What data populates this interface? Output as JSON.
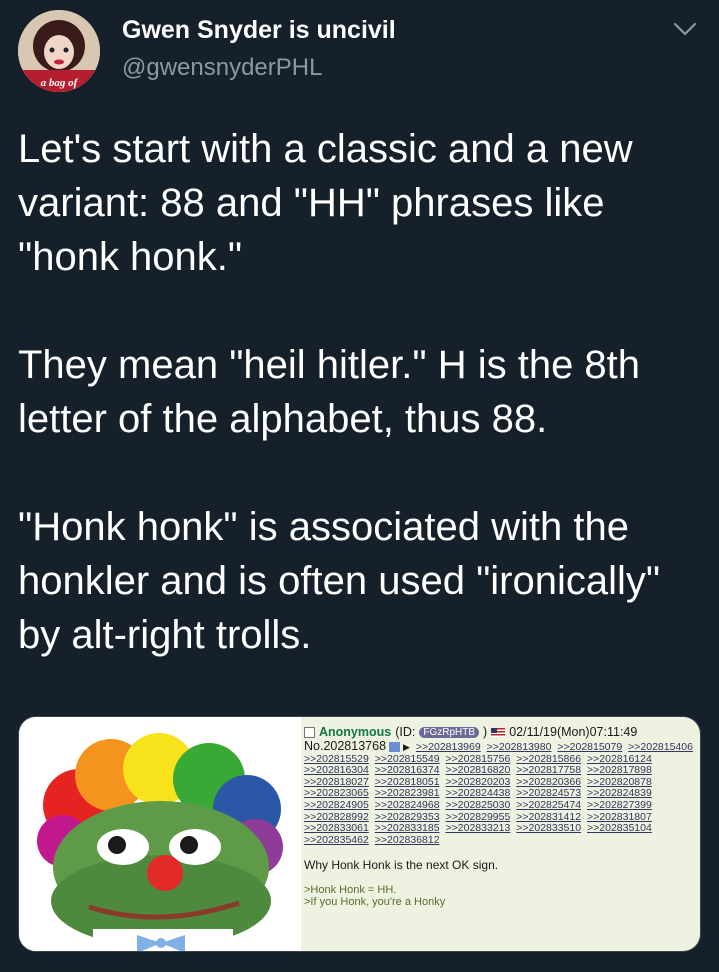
{
  "tweet": {
    "display_name": "Gwen Snyder is uncivil",
    "handle": "@gwensnyderPHL",
    "avatar_text": "a bag of",
    "paragraphs": [
      "Let's start with a classic and a new variant: 88 and \"HH\" phrases like \"honk honk.\"",
      "They mean \"heil hitler.\" H is the 8th letter of the alphabet, thus 88.",
      "\"Honk honk\" is associated with the honkler and is often used \"ironically\" by alt-right trolls."
    ]
  },
  "media": {
    "post": {
      "name": "Anonymous",
      "id_label": "(ID:",
      "id_value": "FGzRpHTB",
      "id_close": ")",
      "datetime": "02/11/19(Mon)07:11:49",
      "post_number": "No.202813768",
      "replies": [
        ">>202813969",
        ">>202813980",
        ">>202815079",
        ">>202815406",
        ">>202815529",
        ">>202815549",
        ">>202815756",
        ">>202815866",
        ">>202816124",
        ">>202816304",
        ">>202816374",
        ">>202816820",
        ">>202817758",
        ">>202817898",
        ">>202818027",
        ">>202818051",
        ">>202820203",
        ">>202820366",
        ">>202820878",
        ">>202823065",
        ">>202823981",
        ">>202824438",
        ">>202824573",
        ">>202824839",
        ">>202824905",
        ">>202824968",
        ">>202825030",
        ">>202825474",
        ">>202827399",
        ">>202828992",
        ">>202829353",
        ">>202829955",
        ">>202831412",
        ">>202831807",
        ">>202833061",
        ">>202833185",
        ">>202833213",
        ">>202833510",
        ">>202835104",
        ">>202835462",
        ">>202836812"
      ],
      "message": "Why Honk Honk is the next OK sign.",
      "greentext": [
        ">Honk Honk = HH.",
        ">If you Honk, you're a Honky"
      ]
    }
  },
  "colors": {
    "background": "#15202b",
    "secondary_text": "#8899a6",
    "greentext": "#5a6e2a",
    "anon_name": "#117743"
  }
}
